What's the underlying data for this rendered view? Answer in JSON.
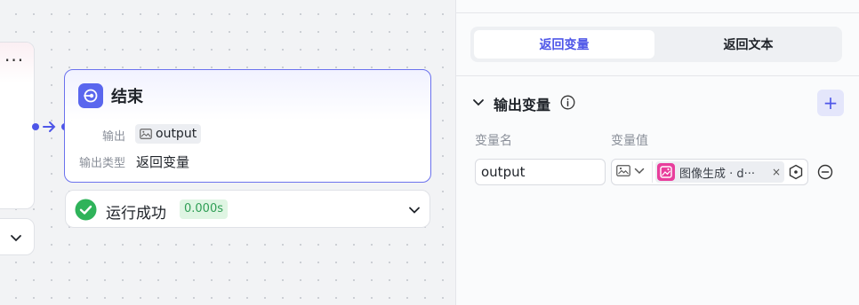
{
  "canvas": {
    "prev_node_menu": "···",
    "end_node": {
      "title": "结束",
      "output_label": "输出",
      "output_value": "output",
      "output_type_label": "输出类型",
      "output_type_value": "返回变量"
    },
    "run_status": {
      "text": "运行成功",
      "time": "0.000s"
    }
  },
  "panel": {
    "tabs": [
      {
        "label": "返回变量",
        "active": true
      },
      {
        "label": "返回文本",
        "active": false
      }
    ],
    "section_title": "输出变量",
    "add_label": "+",
    "columns": {
      "name": "变量名",
      "value": "变量值"
    },
    "row": {
      "name_value": "output",
      "reference_text": "图像生成 · d···",
      "reference_close": "×"
    }
  },
  "colors": {
    "accent": "#4e56e8",
    "end_icon": "#5a67ee",
    "success": "#2fb35a",
    "reference_icon": "#e83e9c"
  }
}
